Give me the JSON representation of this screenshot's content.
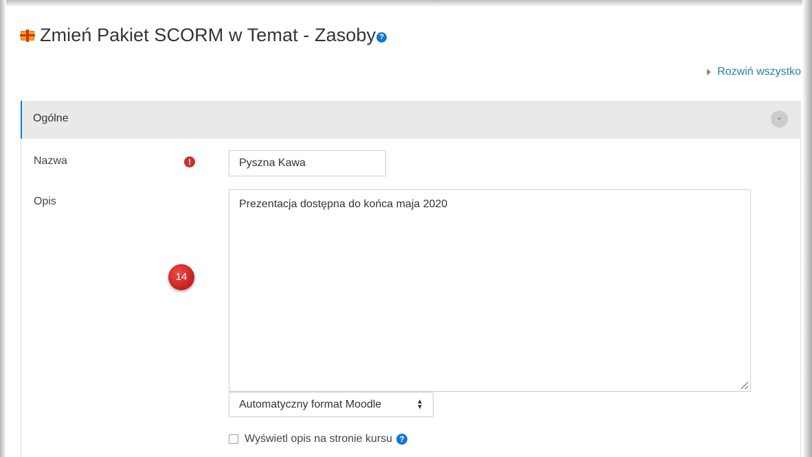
{
  "header": {
    "title": "Zmień Pakiet SCORM w Temat - Zasoby",
    "module_icon": "package-icon",
    "help_icon": "question-circle-icon"
  },
  "expand_all": {
    "label": "Rozwiń wszystko"
  },
  "section": {
    "title": "Ogólne",
    "collapse_symbol": "-"
  },
  "fields": {
    "name": {
      "label": "Nazwa",
      "required_icon": "!",
      "value": "Pyszna Kawa"
    },
    "description": {
      "label": "Opis",
      "value": "Prezentacja dostępna do końca maja 2020"
    },
    "format": {
      "selected": "Automatyczny format Moodle",
      "arrows": "⬍"
    },
    "show_description": {
      "label": "Wyświetl opis na stronie kursu",
      "checked": false
    }
  },
  "callout": {
    "number": "14"
  },
  "colors": {
    "accent": "#1177d1",
    "link": "#2a7ab0",
    "required": "#c9302c",
    "section_bg": "#e9e9e9",
    "callout": "#d92b2b"
  }
}
